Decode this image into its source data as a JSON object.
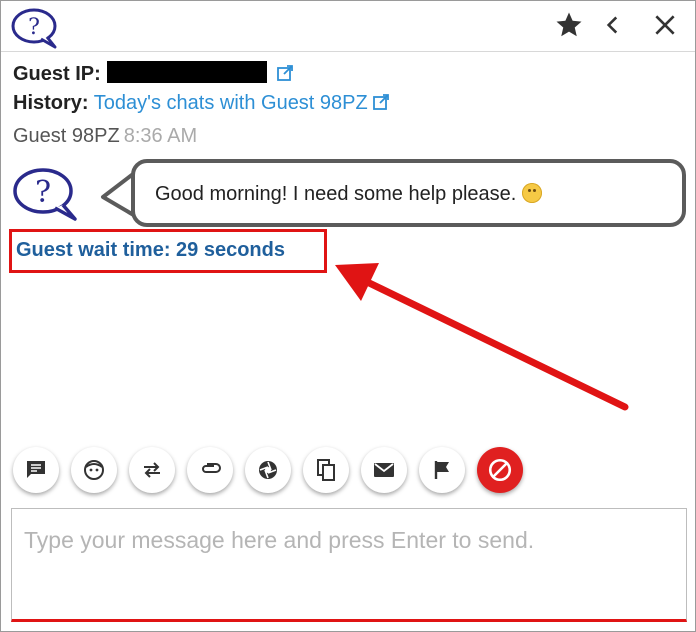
{
  "titlebar": {
    "icons": [
      "question-logo-icon",
      "star-icon",
      "chevron-left-icon",
      "close-icon"
    ]
  },
  "guest_info": {
    "ip_label": "Guest IP:",
    "history_label": "History:",
    "history_link": "Today's chats with Guest 98PZ"
  },
  "message": {
    "sender": "Guest 98PZ",
    "time": "8:36 AM",
    "text": "Good morning! I need some help please."
  },
  "wait": {
    "text": "Guest wait time: 29 seconds"
  },
  "toolbar": {
    "buttons": [
      "chat-icon",
      "face-icon",
      "transfer-icon",
      "attachment-icon",
      "camera-shutter-icon",
      "copy-icon",
      "email-icon",
      "flag-icon",
      "block-icon"
    ]
  },
  "composer": {
    "placeholder": "Type your message here and press Enter to send."
  },
  "colors": {
    "link": "#2d8fd5",
    "wait_text": "#1f5f9c",
    "highlight": "#e01414",
    "block_button": "#e02020",
    "logo": "#2a2a8c"
  }
}
